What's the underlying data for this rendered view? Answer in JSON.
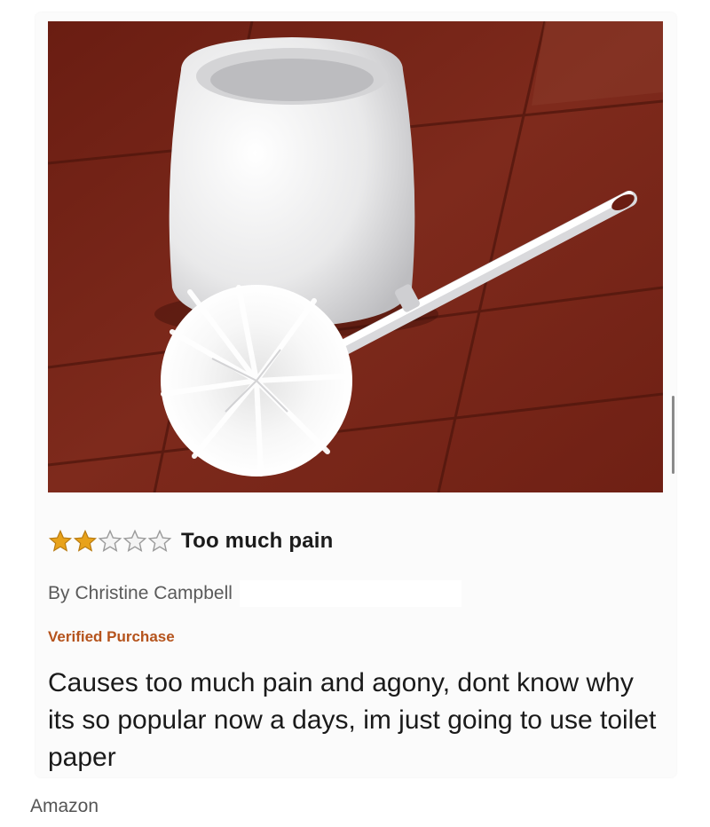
{
  "review": {
    "rating": 2,
    "max_rating": 5,
    "title": "Too much pain",
    "author_prefix": "By",
    "author": "Christine Campbell",
    "verified": "Verified Purchase",
    "body": "Causes too much pain and agony, dont know why its so popular now a days, im just going to use toilet paper"
  },
  "source": "Amazon",
  "colors": {
    "star_filled": "#e8a21a",
    "star_empty_outline": "#9a9a9a",
    "verified": "#b5531c",
    "floor_tile": "#7a2418",
    "grout": "#5a1a10"
  },
  "image": {
    "subject": "toilet-brush-and-holder"
  }
}
